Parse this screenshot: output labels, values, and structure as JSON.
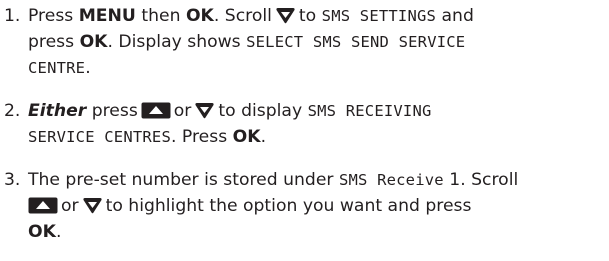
{
  "steps": [
    {
      "number": "1.",
      "lines": [
        {
          "press": "Press",
          "menu": "MENU",
          "then": "then",
          "ok": "OK",
          "scroll": ". Scroll",
          "to": "to",
          "sms_settings": "SMS SETTINGS",
          "and": "and"
        },
        {
          "press": "press",
          "ok": "OK",
          "display_shows": ". Display shows",
          "select_sms": "SELECT SMS SEND SERVICE"
        },
        {
          "centre": "CENTRE",
          "period": "."
        }
      ]
    },
    {
      "number": "2.",
      "lines": [
        {
          "either": "Either",
          "press": "press",
          "or": "or",
          "to_display": "to display",
          "sms_receiving": "SMS RECEIVING"
        },
        {
          "service_centres": "SERVICE CENTRES",
          "press": ". Press",
          "ok": "OK",
          "period": "."
        }
      ]
    },
    {
      "number": "3.",
      "lines": [
        {
          "preset": "The pre-set number is stored under",
          "sms_receive": "SMS Receive",
          "one_scroll": "1. Scroll"
        },
        {
          "or": "or",
          "highlight": "to highlight the option you want and press"
        },
        {
          "ok": "OK",
          "period": "."
        }
      ]
    }
  ]
}
